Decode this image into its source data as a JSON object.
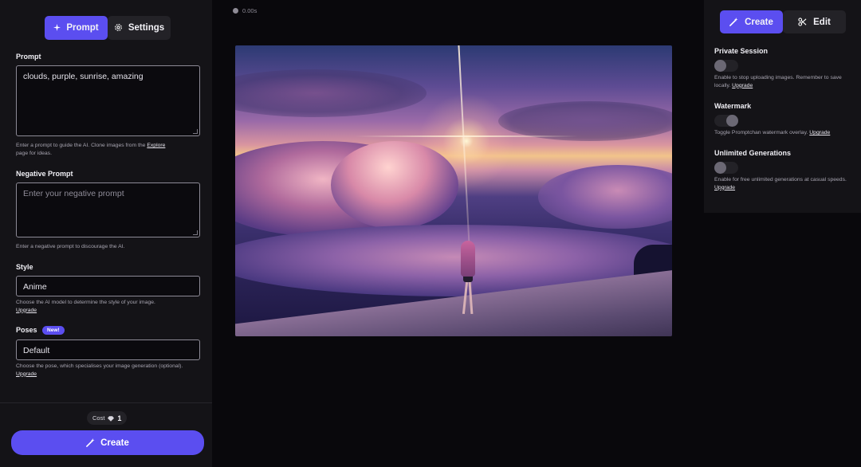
{
  "left_tabs": {
    "prompt": "Prompt",
    "settings": "Settings"
  },
  "prompt": {
    "label": "Prompt",
    "value": "clouds, purple, sunrise, amazing",
    "hint": "Enter a prompt to guide the AI. Clone images from the ",
    "hint_link": "Explore",
    "hint_suffix": "page for ideas."
  },
  "negative_prompt": {
    "label": "Negative Prompt",
    "placeholder": "Enter your negative prompt",
    "hint": "Enter a negative prompt to discourage the AI."
  },
  "style": {
    "label": "Style",
    "value": "Anime",
    "hint": "Choose the AI model to determine the style of your image.",
    "hint_link": "Upgrade"
  },
  "poses": {
    "label": "Poses",
    "badge": "New!",
    "value": "Default",
    "hint": "Choose the pose, which specialises your image generation (optional).",
    "hint_link": "Upgrade"
  },
  "cost": {
    "label": "Cost",
    "value": "1"
  },
  "create_button": "Create",
  "timer": "0.00s",
  "right_tabs": {
    "create": "Create",
    "edit": "Edit"
  },
  "private_session": {
    "label": "Private Session",
    "hint": "Enable to stop uploading images. Remember to save locally.",
    "hint_link": "Upgrade"
  },
  "watermark": {
    "label": "Watermark",
    "hint": "Toggle Promptchan watermark overlay.",
    "hint_link": "Upgrade"
  },
  "unlimited_generations": {
    "label": "Unlimited Generations",
    "hint": "Enable for free unlimited generations at casual speeds.",
    "hint_link": "Upgrade"
  },
  "colors": {
    "accent": "#5b4ef0",
    "panel": "#141317",
    "background": "#09080c"
  },
  "icons": {
    "prompt_tab": "sparkle-icon",
    "settings_tab": "gear-icon",
    "create": "magic-wand-icon",
    "edit": "scissors-icon",
    "cost": "gem-icon",
    "timer": "clock-icon"
  }
}
